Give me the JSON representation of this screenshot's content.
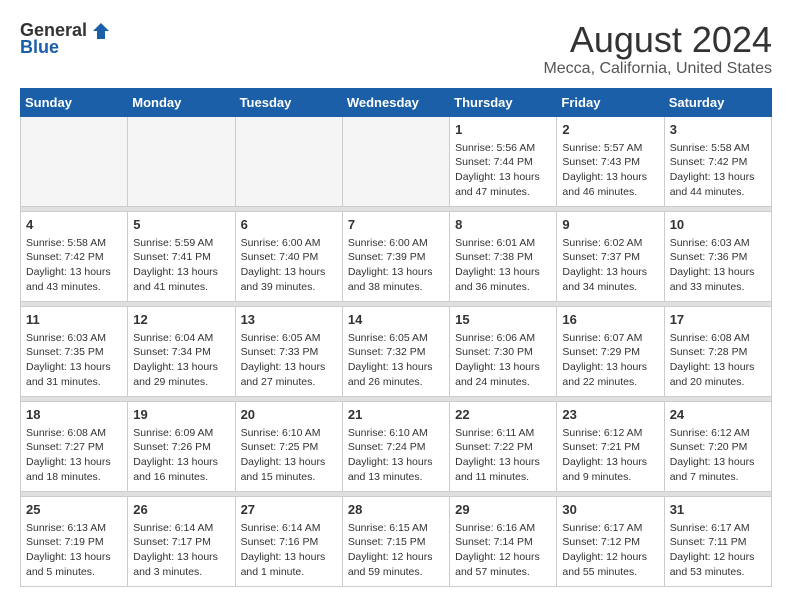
{
  "header": {
    "logo_general": "General",
    "logo_blue": "Blue",
    "title": "August 2024",
    "subtitle": "Mecca, California, United States"
  },
  "weekdays": [
    "Sunday",
    "Monday",
    "Tuesday",
    "Wednesday",
    "Thursday",
    "Friday",
    "Saturday"
  ],
  "weeks": [
    [
      {
        "day": "",
        "info": ""
      },
      {
        "day": "",
        "info": ""
      },
      {
        "day": "",
        "info": ""
      },
      {
        "day": "",
        "info": ""
      },
      {
        "day": "1",
        "info": "Sunrise: 5:56 AM\nSunset: 7:44 PM\nDaylight: 13 hours\nand 47 minutes."
      },
      {
        "day": "2",
        "info": "Sunrise: 5:57 AM\nSunset: 7:43 PM\nDaylight: 13 hours\nand 46 minutes."
      },
      {
        "day": "3",
        "info": "Sunrise: 5:58 AM\nSunset: 7:42 PM\nDaylight: 13 hours\nand 44 minutes."
      }
    ],
    [
      {
        "day": "4",
        "info": "Sunrise: 5:58 AM\nSunset: 7:42 PM\nDaylight: 13 hours\nand 43 minutes."
      },
      {
        "day": "5",
        "info": "Sunrise: 5:59 AM\nSunset: 7:41 PM\nDaylight: 13 hours\nand 41 minutes."
      },
      {
        "day": "6",
        "info": "Sunrise: 6:00 AM\nSunset: 7:40 PM\nDaylight: 13 hours\nand 39 minutes."
      },
      {
        "day": "7",
        "info": "Sunrise: 6:00 AM\nSunset: 7:39 PM\nDaylight: 13 hours\nand 38 minutes."
      },
      {
        "day": "8",
        "info": "Sunrise: 6:01 AM\nSunset: 7:38 PM\nDaylight: 13 hours\nand 36 minutes."
      },
      {
        "day": "9",
        "info": "Sunrise: 6:02 AM\nSunset: 7:37 PM\nDaylight: 13 hours\nand 34 minutes."
      },
      {
        "day": "10",
        "info": "Sunrise: 6:03 AM\nSunset: 7:36 PM\nDaylight: 13 hours\nand 33 minutes."
      }
    ],
    [
      {
        "day": "11",
        "info": "Sunrise: 6:03 AM\nSunset: 7:35 PM\nDaylight: 13 hours\nand 31 minutes."
      },
      {
        "day": "12",
        "info": "Sunrise: 6:04 AM\nSunset: 7:34 PM\nDaylight: 13 hours\nand 29 minutes."
      },
      {
        "day": "13",
        "info": "Sunrise: 6:05 AM\nSunset: 7:33 PM\nDaylight: 13 hours\nand 27 minutes."
      },
      {
        "day": "14",
        "info": "Sunrise: 6:05 AM\nSunset: 7:32 PM\nDaylight: 13 hours\nand 26 minutes."
      },
      {
        "day": "15",
        "info": "Sunrise: 6:06 AM\nSunset: 7:30 PM\nDaylight: 13 hours\nand 24 minutes."
      },
      {
        "day": "16",
        "info": "Sunrise: 6:07 AM\nSunset: 7:29 PM\nDaylight: 13 hours\nand 22 minutes."
      },
      {
        "day": "17",
        "info": "Sunrise: 6:08 AM\nSunset: 7:28 PM\nDaylight: 13 hours\nand 20 minutes."
      }
    ],
    [
      {
        "day": "18",
        "info": "Sunrise: 6:08 AM\nSunset: 7:27 PM\nDaylight: 13 hours\nand 18 minutes."
      },
      {
        "day": "19",
        "info": "Sunrise: 6:09 AM\nSunset: 7:26 PM\nDaylight: 13 hours\nand 16 minutes."
      },
      {
        "day": "20",
        "info": "Sunrise: 6:10 AM\nSunset: 7:25 PM\nDaylight: 13 hours\nand 15 minutes."
      },
      {
        "day": "21",
        "info": "Sunrise: 6:10 AM\nSunset: 7:24 PM\nDaylight: 13 hours\nand 13 minutes."
      },
      {
        "day": "22",
        "info": "Sunrise: 6:11 AM\nSunset: 7:22 PM\nDaylight: 13 hours\nand 11 minutes."
      },
      {
        "day": "23",
        "info": "Sunrise: 6:12 AM\nSunset: 7:21 PM\nDaylight: 13 hours\nand 9 minutes."
      },
      {
        "day": "24",
        "info": "Sunrise: 6:12 AM\nSunset: 7:20 PM\nDaylight: 13 hours\nand 7 minutes."
      }
    ],
    [
      {
        "day": "25",
        "info": "Sunrise: 6:13 AM\nSunset: 7:19 PM\nDaylight: 13 hours\nand 5 minutes."
      },
      {
        "day": "26",
        "info": "Sunrise: 6:14 AM\nSunset: 7:17 PM\nDaylight: 13 hours\nand 3 minutes."
      },
      {
        "day": "27",
        "info": "Sunrise: 6:14 AM\nSunset: 7:16 PM\nDaylight: 13 hours\nand 1 minute."
      },
      {
        "day": "28",
        "info": "Sunrise: 6:15 AM\nSunset: 7:15 PM\nDaylight: 12 hours\nand 59 minutes."
      },
      {
        "day": "29",
        "info": "Sunrise: 6:16 AM\nSunset: 7:14 PM\nDaylight: 12 hours\nand 57 minutes."
      },
      {
        "day": "30",
        "info": "Sunrise: 6:17 AM\nSunset: 7:12 PM\nDaylight: 12 hours\nand 55 minutes."
      },
      {
        "day": "31",
        "info": "Sunrise: 6:17 AM\nSunset: 7:11 PM\nDaylight: 12 hours\nand 53 minutes."
      }
    ]
  ]
}
